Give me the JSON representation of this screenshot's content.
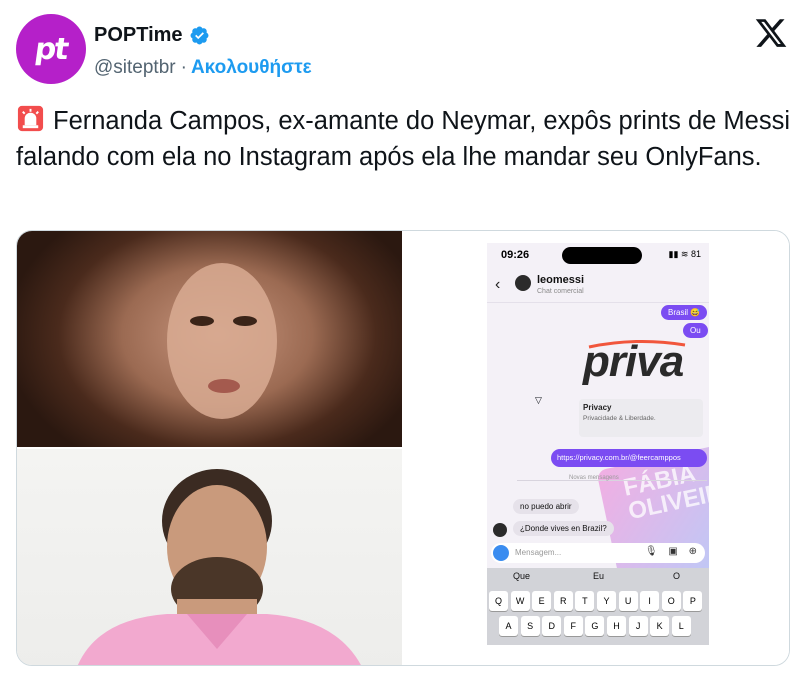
{
  "account": {
    "avatar_text": "pt",
    "display_name": "POPTime",
    "handle": "@siteptbr",
    "separator": "·",
    "follow_label": "Ακολουθήστε",
    "verified_icon": "verified-badge-icon",
    "platform_icon": "x-logo-icon"
  },
  "tweet": {
    "emoji_icon": "police-siren-icon",
    "text": "Fernanda Campos, ex-amante do Neymar, expôs prints de Messi falando com ela no Instagram após ela lhe mandar seu OnlyFans."
  },
  "screenshot": {
    "status_time": "09:26",
    "status_icons": "▮▮ ≋ 81",
    "contact_name": "leomessi",
    "contact_subtitle": "Chat comercial",
    "bubble_brasil": "Brasil 😅",
    "bubble_ou": "Ou",
    "brand_logo": "priva",
    "card_title": "Privacy",
    "card_subtitle": "Privacidade & Liberdade.",
    "link_text": "https://privacy.com.br/@feercamppos",
    "notice_text": "Novas mensagens",
    "msg_no_puedo": "no puedo abrir",
    "msg_donde": "¿Donde vives en Brazil?",
    "composer_placeholder": "Mensagem...",
    "composer_icons": "🎙 ▣ ⊕",
    "watermark_text": "FÁBIA OLIVEIRA",
    "suggestions": [
      "Que",
      "Eu",
      "O"
    ],
    "keys_row1": [
      "Q",
      "W",
      "E",
      "R",
      "T",
      "Y",
      "U",
      "I",
      "O",
      "P"
    ],
    "keys_row2": [
      "A",
      "S",
      "D",
      "F",
      "G",
      "H",
      "J",
      "K",
      "L"
    ]
  },
  "colors": {
    "avatar_bg": "#b520c9",
    "link_blue": "#1d9bf0",
    "verified_blue": "#1d9bf0",
    "bubble_purple": "#7b4cf2",
    "text_primary": "#0f1419",
    "text_secondary": "#536471"
  }
}
